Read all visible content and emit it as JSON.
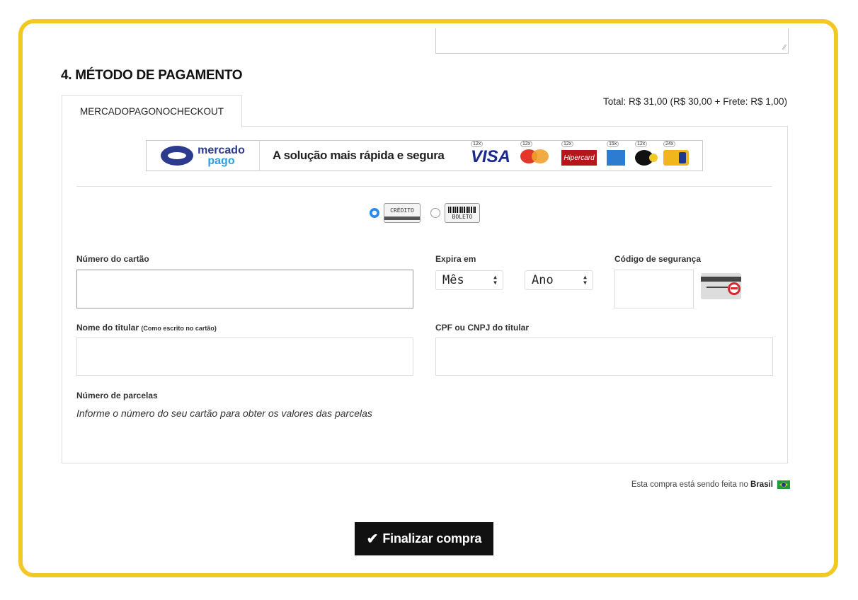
{
  "section": {
    "title": "4. MÉTODO DE PAGAMENTO",
    "tab_label": "MERCADOPAGONOCHECKOUT",
    "total": "Total: R$ 31,00 (R$ 30,00 + Frete: R$ 1,00)"
  },
  "banner": {
    "logo_line1": "mercado",
    "logo_line2": "pago",
    "slogan": "A solução mais rápida e segura",
    "cards": [
      {
        "name": "VISA",
        "installments": "12x"
      },
      {
        "name": "mastercard",
        "installments": "12x"
      },
      {
        "name": "Hipercard",
        "installments": "12x"
      },
      {
        "name": "amex",
        "installments": "15x"
      },
      {
        "name": "elo",
        "installments": "12x"
      },
      {
        "name": "hipercard-2",
        "installments": "24x"
      }
    ]
  },
  "payment_methods": {
    "credit": {
      "label": "CRÉDITO",
      "selected": true
    },
    "boleto": {
      "label": "BOLETO",
      "selected": false
    }
  },
  "form": {
    "card_number_label": "Número do cartão",
    "card_number_value": "",
    "expires_label": "Expira em",
    "month_value": "Mês",
    "year_value": "Ano",
    "cvv_label": "Código de segurança",
    "cvv_value": "",
    "holder_label": "Nome do titular",
    "holder_hint": "(Como escrito no cartão)",
    "holder_value": "",
    "doc_label": "CPF ou CNPJ do titular",
    "doc_value": "",
    "installments_label": "Número de parcelas",
    "installments_hint": "Informe o número do seu cartão para obter os valores das parcelas"
  },
  "footer": {
    "country_text": "Esta compra está sendo feita no",
    "country_name": "Brasil",
    "finish_label": "Finalizar compra"
  },
  "colors": {
    "frame": "#f2c827",
    "button_bg": "#111111",
    "radio_selected": "#2a8af0"
  }
}
